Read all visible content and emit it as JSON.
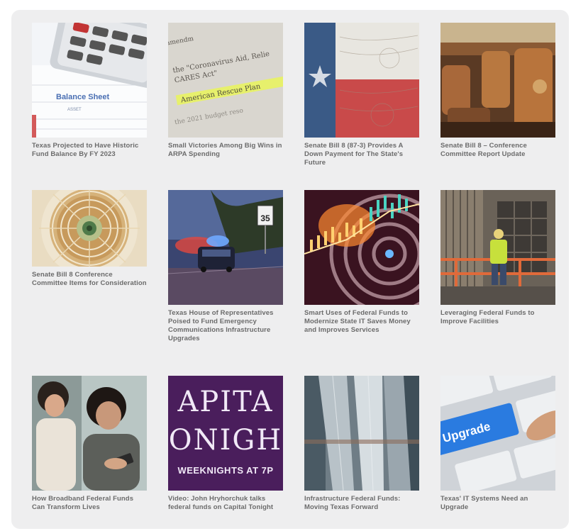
{
  "articles": [
    {
      "title": "Texas Projected to Have Historic Fund Balance By FY 2023",
      "image": "balance-sheet-calculator",
      "image_text": "Balance Sheet"
    },
    {
      "title": "Small Victories Among Big Wins in ARPA Spending",
      "image": "arpa-document",
      "image_text": "American Rescue Plan"
    },
    {
      "title": "Senate Bill 8 (87-3) Provides A Down Payment for The State's Future",
      "image": "texas-flag-money"
    },
    {
      "title": "Senate Bill 8 – Conference Committee Report Update",
      "image": "senate-chamber-chairs"
    },
    {
      "title": "Senate Bill 8 Conference Committee Items for Consideration",
      "image": "capitol-dome"
    },
    {
      "title": "Texas House of Representatives Poised to Fund Emergency Communications Infrastructure Upgrades",
      "image": "police-car-night",
      "image_text": "35"
    },
    {
      "title": "Smart Uses of Federal Funds to Modernize State IT Saves Money and Improves Services",
      "image": "financial-chart-target"
    },
    {
      "title": "Leveraging Federal Funds to Improve Facilities",
      "image": "construction-worker"
    },
    {
      "title": "How Broadband Federal Funds Can Transform Lives",
      "image": "mother-daughter-phone"
    },
    {
      "title": "Video: John Hryhorchuk talks federal funds on Capital Tonight",
      "image": "capital-tonight-poster",
      "poster_line1": "APITA",
      "poster_line2": "ONIGH",
      "poster_line3": "WEEKNIGHTS AT 7P"
    },
    {
      "title": "Infrastructure Federal Funds: Moving Texas Forward",
      "image": "highway-overpass"
    },
    {
      "title": "Texas' IT Systems Need an Upgrade",
      "image": "upgrade-keyboard",
      "image_text": "Upgrade"
    }
  ]
}
